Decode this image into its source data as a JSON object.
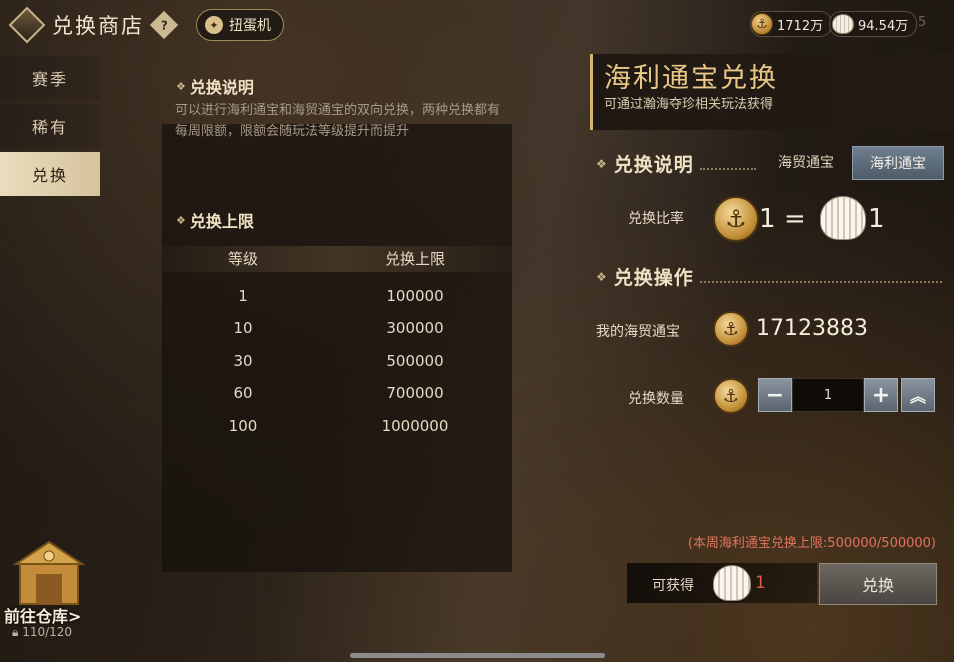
{
  "header": {
    "title": "兑换商店",
    "help_glyph": "?",
    "gacha_label": "扭蛋机",
    "currency_coin": "1712万",
    "currency_shell": "94.54万",
    "edge_digit": "5"
  },
  "sidebar": {
    "items": [
      {
        "label": "赛季",
        "active": false
      },
      {
        "label": "稀有",
        "active": false
      },
      {
        "label": "兑换",
        "active": true
      }
    ]
  },
  "info_panel": {
    "explain_title": "兑换说明",
    "explain_text": "可以进行海利通宝和海贸通宝的双向兑换，两种兑换都有每周限额，限额会随玩法等级提升而提升",
    "limit_title": "兑换上限",
    "table": {
      "headers": [
        "等级",
        "兑换上限"
      ],
      "rows": [
        [
          "1",
          "100000"
        ],
        [
          "10",
          "300000"
        ],
        [
          "30",
          "500000"
        ],
        [
          "60",
          "700000"
        ],
        [
          "100",
          "1000000"
        ]
      ]
    }
  },
  "warehouse": {
    "label": "前往仓库",
    "arrow": ">",
    "capacity": "110/120"
  },
  "exchange_panel": {
    "title": "海利通宝兑换",
    "subtitle": "可通过瀚海夺珍相关玩法获得",
    "explain_title": "兑换说明",
    "toggle_options": [
      "海贸通宝",
      "海利通宝"
    ],
    "selected_toggle": "海利通宝",
    "rate_label": "兑换比率",
    "rate_left": "1",
    "rate_equals": "=",
    "rate_right": "1",
    "operation_title": "兑换操作",
    "my_balance_label": "我的海贸通宝",
    "my_balance": "17123883",
    "quantity_label": "兑换数量",
    "quantity": "1",
    "weekly_limit_text": "(本周海利通宝兑换上限:500000/500000)",
    "obtain_label": "可获得",
    "obtain_amount": "1",
    "exchange_button": "兑换"
  },
  "icons": {
    "coin": "anchor-coin-icon",
    "shell": "shell-icon"
  },
  "colors": {
    "accent_gold": "#d4b56e",
    "limit_red": "#e0735e",
    "active_tab": "#e9dcbc"
  }
}
